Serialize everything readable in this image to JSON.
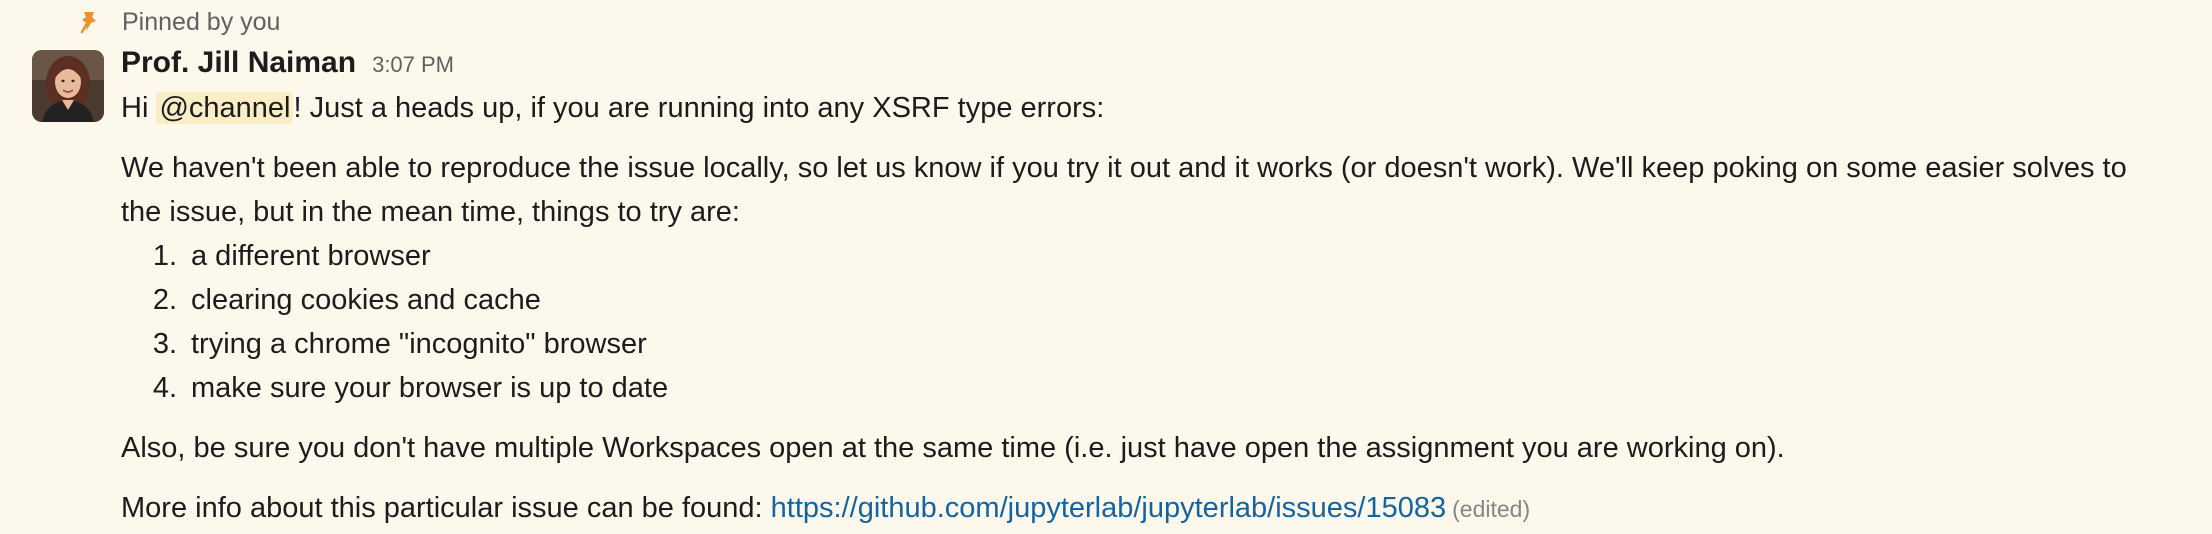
{
  "pinned": {
    "label": "Pinned by you",
    "icon": "pin-icon",
    "icon_color": "#e8912d"
  },
  "message": {
    "avatar_icon": "avatar",
    "author": "Prof. Jill Naiman",
    "timestamp": "3:07 PM",
    "line1_prefix": "Hi",
    "mention": "@channel",
    "line1_suffix": "!  Just a heads up, if you are running into any XSRF type errors:",
    "paragraph2_line1": "We haven't been able to reproduce the issue locally, so let us know if you try it out and it works (or doesn't work).  We'll keep poking on some easier solves to",
    "paragraph2_line2": "the issue, but in the mean time, things to try are:",
    "list": [
      {
        "num": "1.",
        "text": "a different browser"
      },
      {
        "num": "2.",
        "text": "clearing cookies and cache"
      },
      {
        "num": "3.",
        "text": "trying a chrome \"incognito\" browser"
      },
      {
        "num": "4.",
        "text": "make sure your browser is up to date"
      }
    ],
    "paragraph3": "Also, be sure you don't have multiple Workspaces open at the same time (i.e. just have open the assignment you are working on).",
    "paragraph4_prefix": "More info about this particular issue can be found:",
    "link_text": "https://github.com/jupyterlab/jupyterlab/issues/15083",
    "edited_label": "(edited)"
  },
  "colors": {
    "background": "#fdf8ec",
    "link": "#1264a3",
    "mention_bg": "#fbedc5"
  }
}
